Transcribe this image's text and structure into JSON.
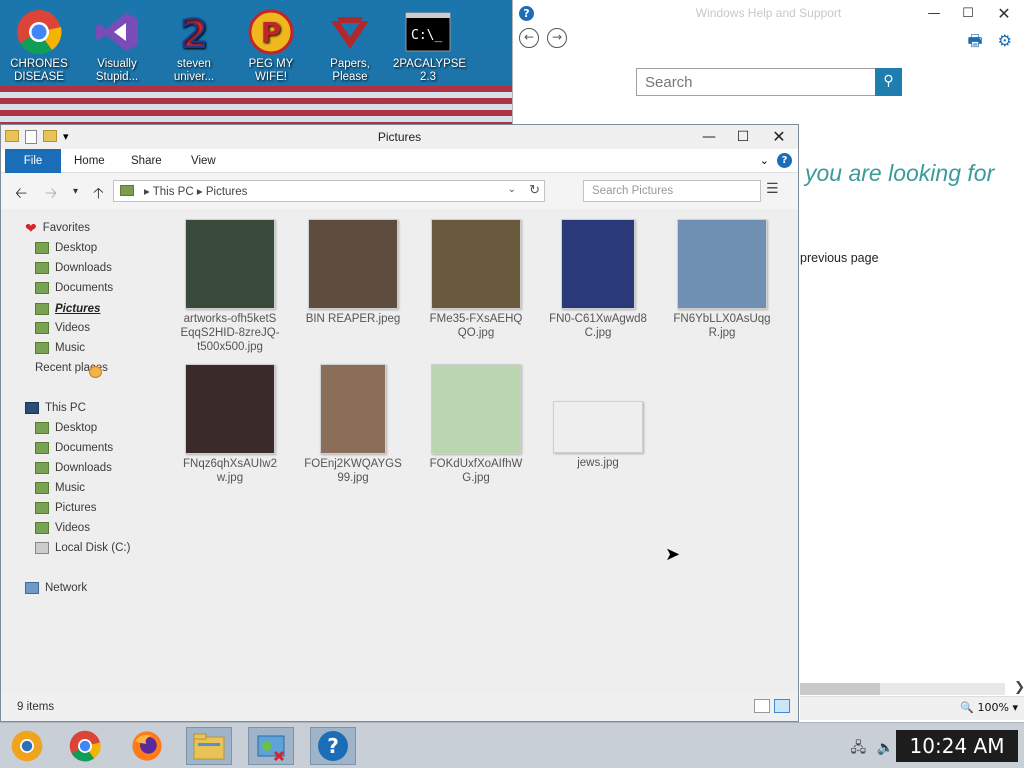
{
  "desktop": {
    "icons": [
      {
        "label": "CHRONES DISEASE",
        "icon": "chrome-icon"
      },
      {
        "label": "Visually Stupid...",
        "icon": "visual-studio-icon"
      },
      {
        "label": "steven univer...",
        "icon": "steven-universe-icon"
      },
      {
        "label": "PEG MY WIFE!",
        "icon": "p-logo-icon"
      },
      {
        "label": "Papers, Please",
        "icon": "papers-please-icon"
      },
      {
        "label": "2PACALYPSE 2.3",
        "icon": "cmd-icon"
      }
    ]
  },
  "help_window": {
    "title": "Windows Help and Support",
    "search_placeholder": "Search",
    "heading": "you are looking for",
    "body_text": "previous page",
    "zoom": "100%"
  },
  "explorer": {
    "title": "Pictures",
    "ribbon_tabs": [
      "File",
      "Home",
      "Share",
      "View"
    ],
    "breadcrumb": [
      "This PC",
      "Pictures"
    ],
    "search_placeholder": "Search Pictures",
    "nav": {
      "favorites": {
        "label": "Favorites",
        "items": [
          "Desktop",
          "Downloads",
          "Documents",
          "Pictures",
          "Videos",
          "Music",
          "Recent places"
        ]
      },
      "this_pc": {
        "label": "This PC",
        "items": [
          "Desktop",
          "Documents",
          "Downloads",
          "Music",
          "Pictures",
          "Videos",
          "Local Disk (C:)"
        ]
      },
      "network": "Network"
    },
    "files": [
      {
        "name": "artworks-ofh5ketSEqqS2HID-8zreJQ-t500x500.jpg",
        "color": "#8b8f8b"
      },
      {
        "name": "BIN REAPER.jpeg",
        "color": "#3a4a3a"
      },
      {
        "name": "FMe35-FXsAEHQQO.jpg",
        "color": "#5e4d3e"
      },
      {
        "name": "FN0-C61XwAgwd8C.jpg",
        "color": "#6a5a3d"
      },
      {
        "name": "FN6YbLLX0AsUqgR.jpg",
        "color": "#2a3a78"
      },
      {
        "name": "FNqz6qhXsAUIw2w.jpg",
        "color": "#6f8fb3"
      },
      {
        "name": "FOEnj2KWQAYGS99.jpg",
        "color": "#3b2a2a"
      },
      {
        "name": "FOKdUxfXoAIfhWG.jpg",
        "color": "#8b6e5a"
      },
      {
        "name": "jews.jpg",
        "color": "#b9d6b0"
      }
    ],
    "status": "9 items"
  },
  "taskbar": {
    "apps": [
      "chrome-canary-icon",
      "chrome-icon",
      "firefox-icon",
      "file-explorer-icon",
      "control-panel-icon",
      "help-icon"
    ],
    "time": "10:24 AM"
  }
}
